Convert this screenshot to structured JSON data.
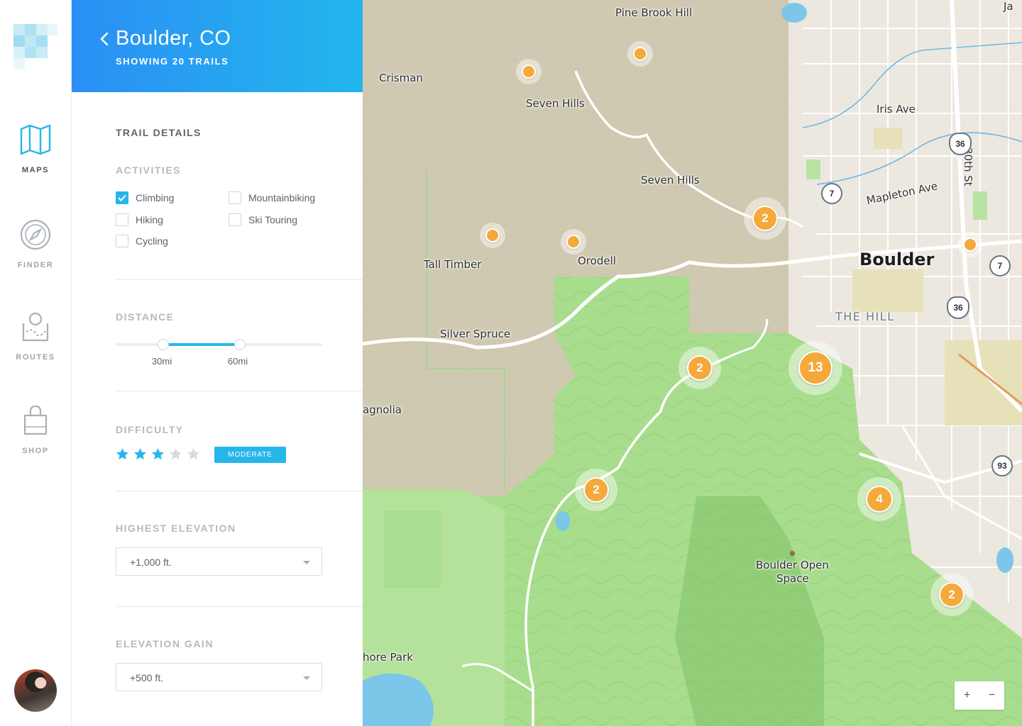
{
  "nav": {
    "items": [
      {
        "label": "MAPS",
        "icon": "map-icon",
        "active": true
      },
      {
        "label": "FINDER",
        "icon": "compass-icon",
        "active": false
      },
      {
        "label": "ROUTES",
        "icon": "routes-icon",
        "active": false
      },
      {
        "label": "SHOP",
        "icon": "shopping-bag-icon",
        "active": false
      }
    ]
  },
  "header": {
    "title": "Boulder, CO",
    "subtitle": "SHOWING 20 TRAILS"
  },
  "details": {
    "title": "TRAIL DETAILS",
    "activities": {
      "title": "ACTIVITIES",
      "options": [
        {
          "label": "Climbing",
          "checked": true
        },
        {
          "label": "Hiking",
          "checked": false
        },
        {
          "label": "Cycling",
          "checked": false
        },
        {
          "label": "Mountainbiking",
          "checked": false
        },
        {
          "label": "Ski Touring",
          "checked": false
        }
      ]
    },
    "distance": {
      "title": "DISTANCE",
      "min_label": "30mi",
      "max_label": "60mi",
      "range_fraction": [
        0.23,
        0.6
      ]
    },
    "difficulty": {
      "title": "DIFFICULTY",
      "stars": 3,
      "max_stars": 5,
      "badge": "MODERATE"
    },
    "highest_elevation": {
      "title": "HIGHEST ELEVATION",
      "value": "+1,000 ft."
    },
    "elevation_gain": {
      "title": "ELEVATION GAIN",
      "value": "+500 ft."
    }
  },
  "map": {
    "labels": {
      "pine_brook_hill": "Pine Brook Hill",
      "crisman": "Crisman",
      "seven_hills_1": "Seven Hills",
      "seven_hills_2": "Seven Hills",
      "tall_timber": "Tall Timber",
      "orodell": "Orodell",
      "silver_spruce": "Silver Spruce",
      "magnolia": "agnolia",
      "shore_park": "hore Park",
      "boulder": "Boulder",
      "the_hill": "THE HILL",
      "iris_ave": "Iris Ave",
      "mapleton_ave": "Mapleton Ave",
      "thirtieth_st": "30th St",
      "open_space_line1": "Boulder Open",
      "open_space_line2": "Space",
      "ja": "Ja"
    },
    "shields": [
      "36",
      "7",
      "7",
      "36",
      "93"
    ],
    "clusters": [
      "2",
      "2",
      "13",
      "2",
      "4",
      "2"
    ],
    "zoom_in": "+",
    "zoom_out": "−"
  },
  "colors": {
    "accent": "#27b6ea",
    "header_start": "#2b8ff5",
    "header_end": "#22b6ec",
    "marker": "#f4a93a"
  }
}
